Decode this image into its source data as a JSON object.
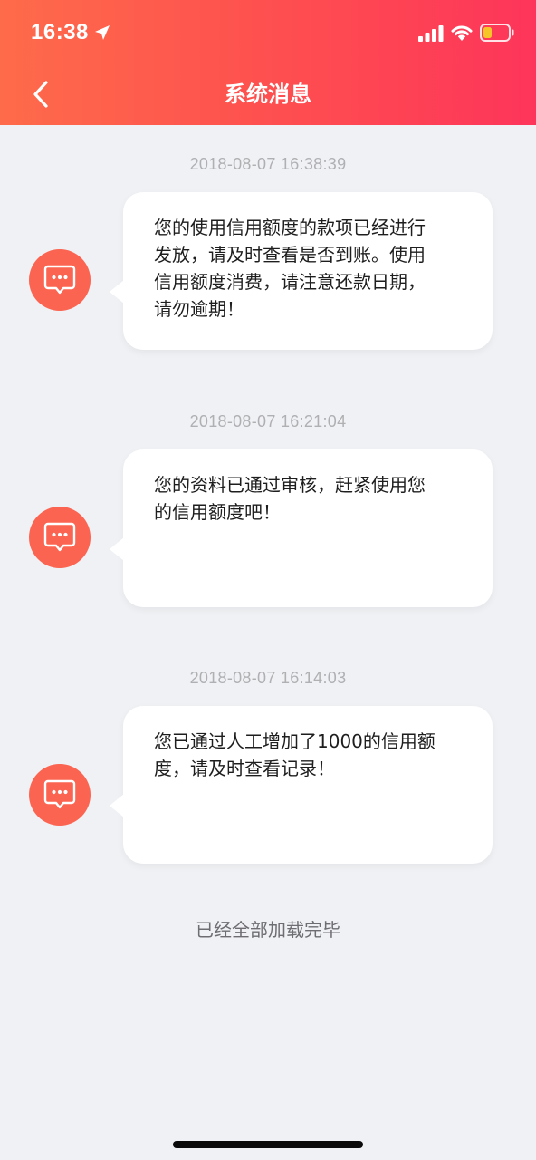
{
  "status_bar": {
    "time": "16:38",
    "icons": [
      "location-arrow-icon",
      "cellular-signal-icon",
      "wifi-icon",
      "battery-low-icon"
    ]
  },
  "nav": {
    "title": "系统消息",
    "back_icon": "chevron-left-icon"
  },
  "colors": {
    "header_gradient": [
      "#fe6b4a",
      "#fd355a"
    ],
    "avatar": "#fb6451",
    "background": "#eff1f4",
    "battery_level": "#f6c528"
  },
  "messages": [
    {
      "timestamp": "2018-08-07 16:38:39",
      "lines": [
        "您的使用信用额度的款项已经进行",
        "发放，请及时查看是否到账。使用",
        "信用额度消费，请注意还款日期，",
        "请勿逾期！"
      ],
      "icon": "message-bubble-icon"
    },
    {
      "timestamp": "2018-08-07 16:21:04",
      "lines": [
        "您的资料已通过审核，赶紧使用您",
        "的信用额度吧！"
      ],
      "icon": "message-bubble-icon"
    },
    {
      "timestamp": "2018-08-07 16:14:03",
      "lines": [
        "您已通过人工增加了1000的信用额",
        "度，请及时查看记录！"
      ],
      "icon": "message-bubble-icon"
    }
  ],
  "footer": {
    "text": "已经全部加载完毕"
  }
}
